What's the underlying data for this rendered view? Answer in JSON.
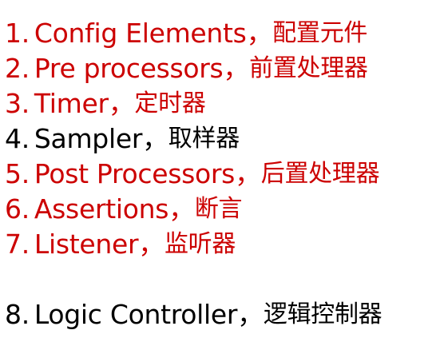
{
  "items": [
    {
      "num": "1.",
      "en": "Config Elements",
      "sep": "，",
      "cn": "配置元件",
      "color": "#cc0000"
    },
    {
      "num": "2.",
      "en": "Pre processors",
      "sep": "，",
      "cn": "前置处理器",
      "color": "#cc0000"
    },
    {
      "num": "3.",
      "en": "Timer",
      "sep": "，",
      "cn": "定时器",
      "color": "#cc0000"
    },
    {
      "num": "4.",
      "en": "Sampler",
      "sep": "，",
      "cn": "取样器",
      "color": "#000000"
    },
    {
      "num": "5.",
      "en": "Post Processors",
      "sep": "，",
      "cn": "后置处理器",
      "color": "#cc0000"
    },
    {
      "num": "6.",
      "en": "Assertions",
      "sep": "，",
      "cn": "断言",
      "color": "#cc0000"
    },
    {
      "num": "7.",
      "en": "Listener",
      "sep": "，",
      "cn": "监听器",
      "color": "#cc0000"
    },
    {
      "num": "8.",
      "en": "Logic Controller",
      "sep": "，",
      "cn": "逻辑控制器",
      "color": "#000000"
    }
  ]
}
